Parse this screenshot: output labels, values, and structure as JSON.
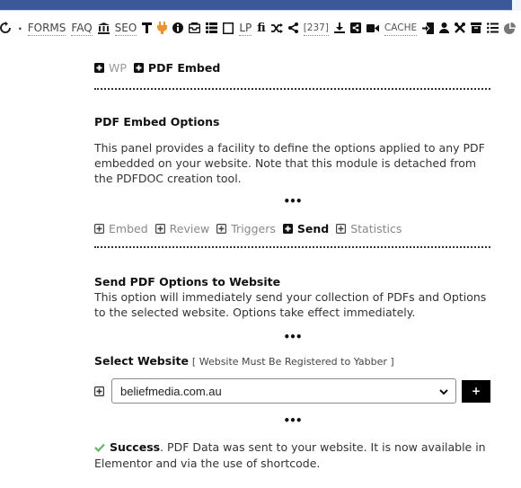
{
  "toolbar": {
    "items": [
      {
        "type": "icon",
        "icon": "refresh-icon"
      },
      {
        "type": "separator",
        "text": "·"
      },
      {
        "type": "link",
        "text": "FORMS"
      },
      {
        "type": "link",
        "text": "FAQ"
      },
      {
        "type": "icon",
        "icon": "bank-icon"
      },
      {
        "type": "link",
        "text": "SEO"
      },
      {
        "type": "icon",
        "icon": "filter-icon"
      },
      {
        "type": "icon",
        "icon": "plug-icon"
      },
      {
        "type": "icon",
        "icon": "info-icon"
      },
      {
        "type": "icon",
        "icon": "inbox-icon"
      },
      {
        "type": "icon",
        "icon": "list-icon"
      },
      {
        "type": "icon",
        "icon": "frame-icon"
      },
      {
        "type": "link",
        "text": "LP"
      },
      {
        "type": "icon",
        "icon": "fi-icon"
      },
      {
        "type": "icon",
        "icon": "shuffle-icon"
      },
      {
        "type": "icon",
        "icon": "share-icon"
      },
      {
        "type": "link",
        "text": "[237]"
      },
      {
        "type": "icon",
        "icon": "download-icon"
      },
      {
        "type": "icon",
        "icon": "share-square-icon"
      },
      {
        "type": "icon",
        "icon": "video-icon"
      },
      {
        "type": "link",
        "text": "CACHE"
      },
      {
        "type": "icon",
        "icon": "sign-in-icon"
      },
      {
        "type": "icon",
        "icon": "user-icon"
      },
      {
        "type": "icon",
        "icon": "tools-icon"
      },
      {
        "type": "icon",
        "icon": "archive-icon"
      },
      {
        "type": "icon",
        "icon": "list-ul-icon"
      },
      {
        "type": "icon",
        "icon": "pie-chart-icon"
      }
    ],
    "labels": {
      "forms": "FORMS",
      "faq": "FAQ",
      "seo": "SEO",
      "lp": "LP",
      "fi": "fi",
      "count": "[237]",
      "cache": "CACHE",
      "dot": "·"
    }
  },
  "top_tabs": [
    {
      "label": "WP",
      "active": false
    },
    {
      "label": "PDF Embed",
      "active": true
    }
  ],
  "intro": {
    "title": "PDF Embed Options",
    "body": "This panel provides a facility to define the options applied to any PDF embedded on your website. Note that this module is detached from the PDFDOC creation tool.",
    "more": "•••"
  },
  "sub_tabs": [
    {
      "label": "Embed",
      "active": false
    },
    {
      "label": "Review",
      "active": false
    },
    {
      "label": "Triggers",
      "active": false
    },
    {
      "label": "Send",
      "active": true
    },
    {
      "label": "Statistics",
      "active": false
    }
  ],
  "send": {
    "title": "Send PDF Options to Website",
    "body": "This option will immediately send your collection of PDFs and Options to the selected website. Options take effect immediately.",
    "more": "•••",
    "select_label": "Select Website",
    "select_hint": "[ Website Must Be Registered to Yabber ]",
    "selected_website": "beliefmedia.com.au",
    "add_button": "+",
    "more2": "•••"
  },
  "status": {
    "strong": "Success",
    "message": ". PDF Data was sent to your website. It is now available in Elementor and via the use of shortcode.",
    "color": "#5cb85c"
  }
}
